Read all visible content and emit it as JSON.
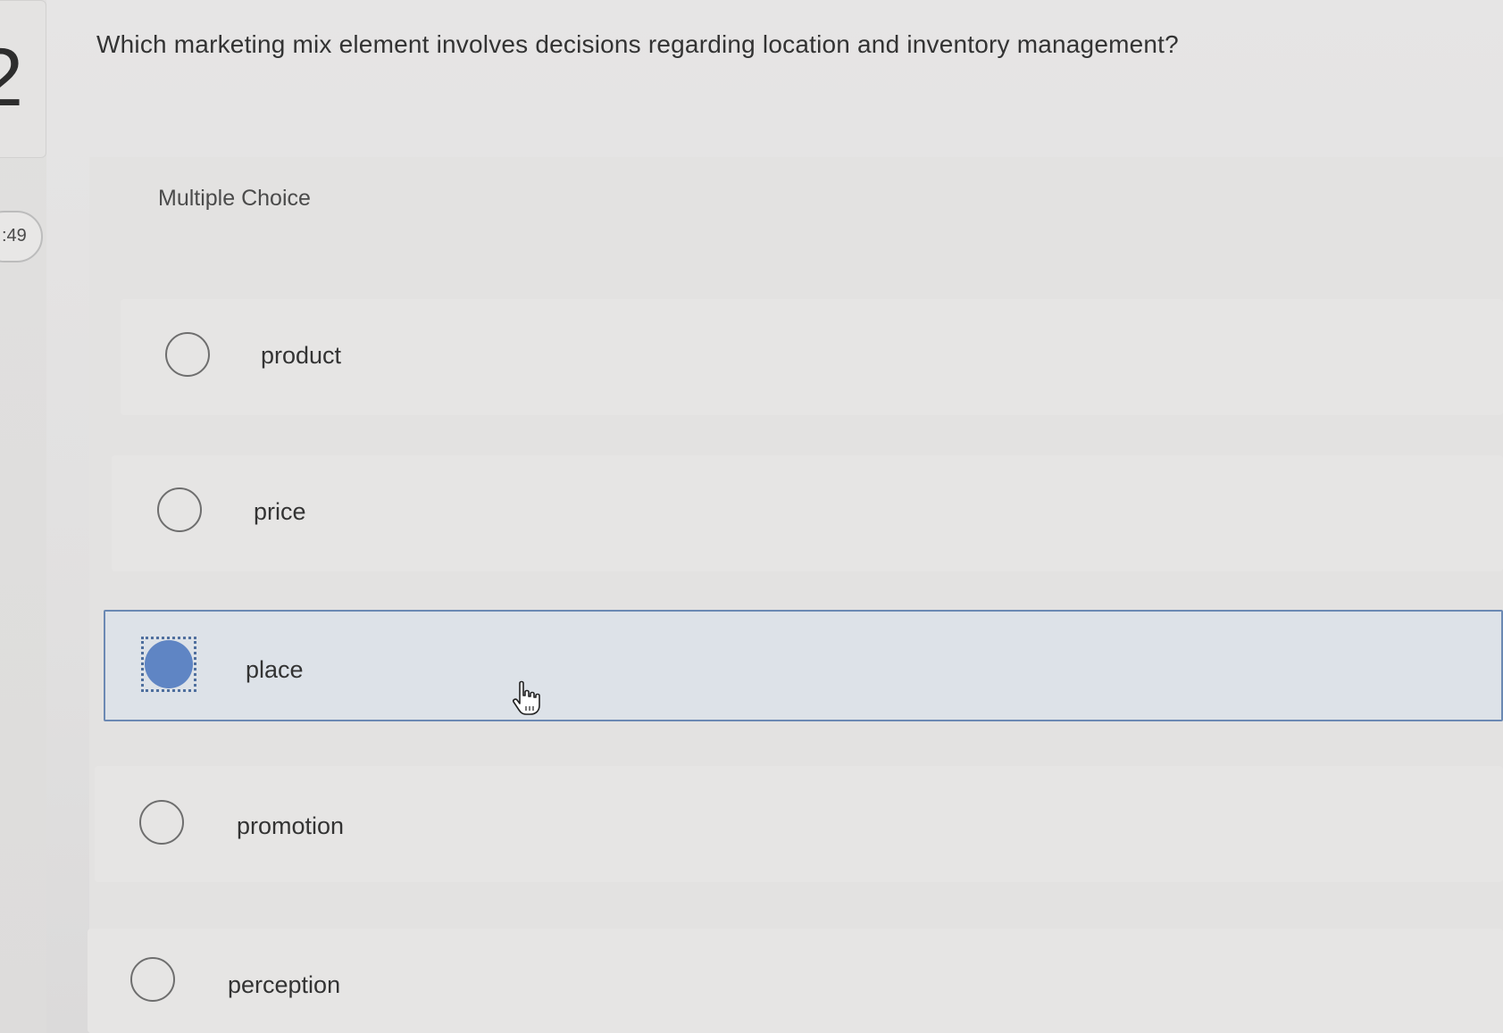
{
  "question": {
    "number": "2",
    "timer": ":49",
    "text": "Which marketing mix element involves decisions regarding location and inventory management?"
  },
  "section_label": "Multiple Choice",
  "options": [
    {
      "label": "product",
      "selected": false
    },
    {
      "label": "price",
      "selected": false
    },
    {
      "label": "place",
      "selected": true
    },
    {
      "label": "promotion",
      "selected": false
    },
    {
      "label": "perception",
      "selected": false
    }
  ],
  "colors": {
    "selected_fill": "#5f85c4",
    "selected_border": "#6b89b3"
  },
  "icons": {
    "cursor": "hand-pointer-icon"
  }
}
